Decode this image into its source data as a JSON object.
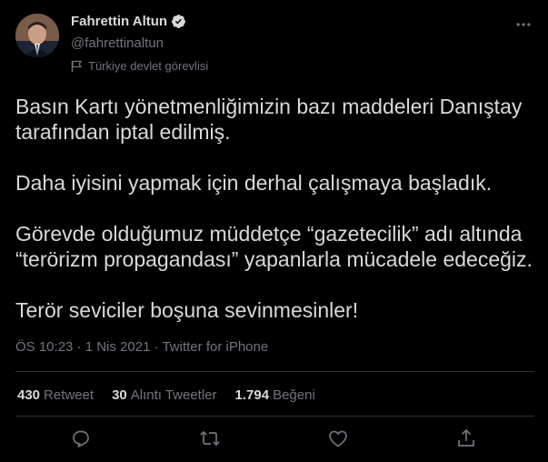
{
  "author": {
    "display_name": "Fahrettin Altun",
    "handle": "@fahrettinaltun",
    "label": "Türkiye devlet görevlisi",
    "verified_icon": "verified-badge-icon",
    "avatar_icon": "avatar"
  },
  "tweet": {
    "paragraphs": [
      "Basın Kartı yönetmenliğimizin bazı maddeleri Danıştay tarafından iptal edilmiş.",
      "Daha iyisini yapmak için derhal çalışmaya başladık.",
      "Görevde olduğumuz müddetçe “gazetecilik” adı altında “terörizm propagandası” yapanlarla mücadele edeceğiz.",
      "Terör seviciler boşuna sevinmesinler!"
    ],
    "meta": "ÖS 10:23 · 1 Nis 2021 · Twitter for iPhone"
  },
  "stats": {
    "retweets_count": "430",
    "retweets_label": "Retweet",
    "quotes_count": "30",
    "quotes_label": "Alıntı Tweetler",
    "likes_count": "1.794",
    "likes_label": "Beğeni"
  },
  "actions": [
    "reply-icon",
    "retweet-icon",
    "like-icon",
    "share-icon"
  ],
  "colors": {
    "background": "#000000",
    "text": "#d9d9d9",
    "secondary": "#6e767d",
    "divider": "#2f3336",
    "verified": "#d9d9d9"
  }
}
